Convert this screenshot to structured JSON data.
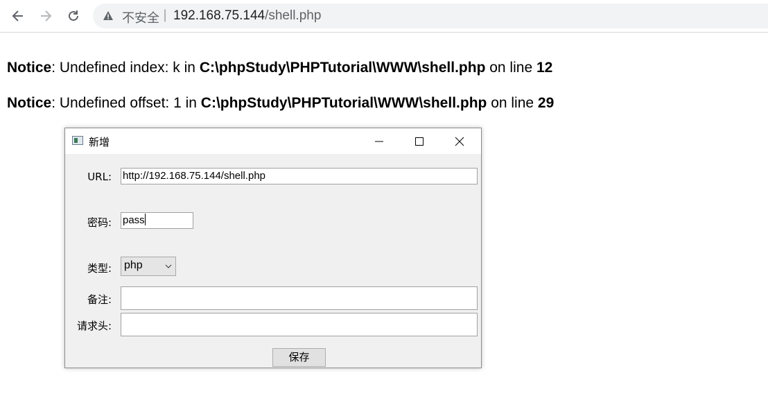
{
  "browser": {
    "security_label": "不安全",
    "separator": "|",
    "url_host": "192.168.75.144",
    "url_path": "/shell.php"
  },
  "notices": [
    {
      "level": "Notice",
      "message": ": Undefined index: k in ",
      "file": "C:\\phpStudy\\PHPTutorial\\WWW\\shell.php",
      "on_line": " on line ",
      "line": "12"
    },
    {
      "level": "Notice",
      "message": ": Undefined offset: 1 in ",
      "file": "C:\\phpStudy\\PHPTutorial\\WWW\\shell.php",
      "on_line": " on line ",
      "line": "29"
    }
  ],
  "dialog": {
    "title": "新增",
    "fields": {
      "url_label": "URL:",
      "url_value": "http://192.168.75.144/shell.php",
      "password_label": "密码:",
      "password_value": "pass",
      "type_label": "类型:",
      "type_value": "php",
      "note_label": "备注:",
      "note_value": "",
      "headers_label": "请求头:",
      "headers_value": ""
    },
    "save_label": "保存"
  }
}
